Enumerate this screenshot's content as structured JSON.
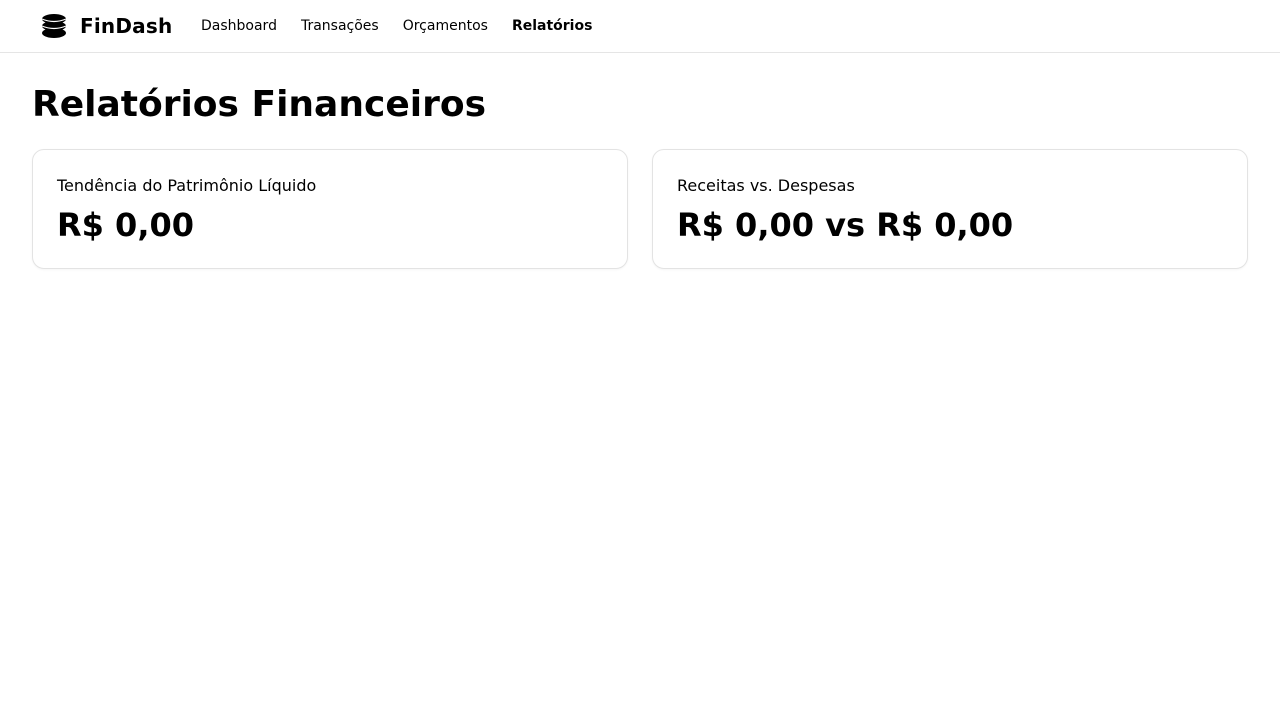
{
  "app": {
    "name": "FinDash",
    "logo_icon": "stacked-coins-icon"
  },
  "nav": {
    "items": [
      {
        "label": "Dashboard",
        "active": false
      },
      {
        "label": "Transações",
        "active": false
      },
      {
        "label": "Orçamentos",
        "active": false
      },
      {
        "label": "Relatórios",
        "active": true
      }
    ]
  },
  "page": {
    "title": "Relatórios Financeiros"
  },
  "cards": [
    {
      "label": "Tendência do Patrimônio Líquido",
      "value": "R$ 0,00"
    },
    {
      "label": "Receitas vs. Despesas",
      "value": "R$ 0,00 vs R$ 0,00"
    }
  ],
  "colors": {
    "text": "#000000",
    "border": "#e5e5e5",
    "background": "#ffffff"
  }
}
